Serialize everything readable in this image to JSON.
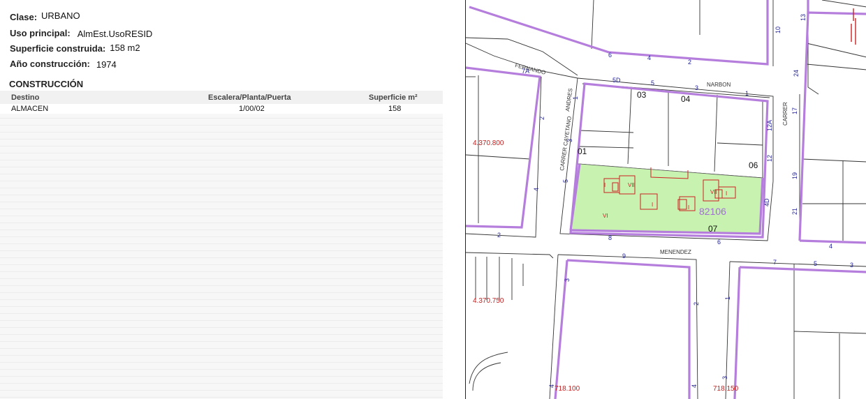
{
  "info": {
    "clase_label": "Clase:",
    "clase_value": "URBANO",
    "uso_label": "Uso principal:",
    "uso_value": "AlmEst.UsoRESID",
    "superficie_label": "Superficie construida:",
    "superficie_value": "158 m2",
    "ano_label": "Año construcción:",
    "ano_value": "1974"
  },
  "construccion": {
    "title": "CONSTRUCCIÓN",
    "headers": [
      "Destino",
      "Escalera/Planta/Puerta",
      "Superficie m²"
    ],
    "rows": [
      [
        "ALMACEN",
        "1/00/02",
        "158"
      ]
    ]
  },
  "map": {
    "parcel_label": "82106",
    "streets": [
      "FERNANDO",
      "NARBON",
      "MENENDEZ",
      "ANDRES",
      "CARRER CAYETANO",
      "CARRER"
    ],
    "coordinate_labels": [
      "4.370.800",
      "4.370.750",
      "718.100",
      "718.150"
    ],
    "sub_parcels": [
      "03",
      "04",
      "01",
      "06",
      "07",
      "5D",
      "7A"
    ],
    "house_numbers": [
      "1",
      "2",
      "3",
      "4",
      "5",
      "6",
      "7",
      "8",
      "9",
      "10",
      "12",
      "12A",
      "13",
      "17",
      "19",
      "21",
      "24",
      "4D",
      "5",
      "4",
      "3",
      "2",
      "1"
    ],
    "floor_labels": [
      "VII",
      "VII",
      "VI",
      "I",
      "I",
      "I",
      "I"
    ],
    "colors": {
      "block_outline": "#b57edc",
      "parcel_fill": "#c7f2b0",
      "building": "#cc2222",
      "house_number": "#22229a",
      "coordinate": "#c02020",
      "parcel_label": "#a070d0"
    }
  }
}
